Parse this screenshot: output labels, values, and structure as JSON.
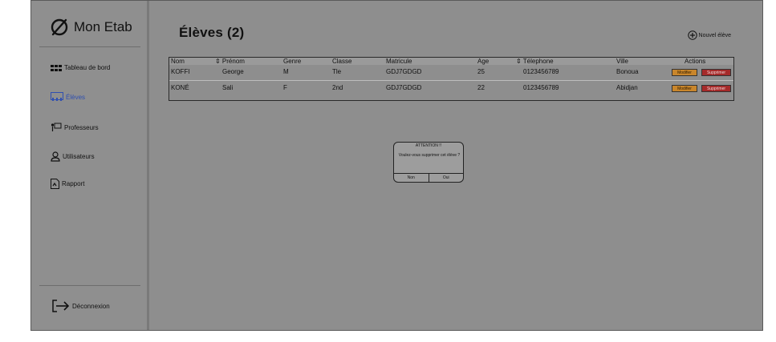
{
  "app": {
    "title": "Mon Etab"
  },
  "sidebar": {
    "items": [
      {
        "label": "Tableau de bord",
        "icon": "grid-icon"
      },
      {
        "label": "Élèves",
        "icon": "students-icon",
        "active": true
      },
      {
        "label": "Professeurs",
        "icon": "teacher-icon"
      },
      {
        "label": "Utilisateurs",
        "icon": "user-icon"
      },
      {
        "label": "Rapport",
        "icon": "report-icon"
      }
    ],
    "logout_label": "Déconnexion"
  },
  "main": {
    "title": "Élèves (2)",
    "new_button_label": "Nouvel élève"
  },
  "table": {
    "columns": [
      "Nom",
      "⇕ Prénom",
      "Genre",
      "Classe",
      "Matricule",
      "Age",
      "⇕ Télephone",
      "Ville",
      "Actions"
    ],
    "rows": [
      {
        "nom": "KOFFI",
        "prenom": "George",
        "genre": "M",
        "classe": "Tle",
        "matricule": "GDJ7GDGD",
        "age": "25",
        "telephone": "0123456789",
        "ville": "Bonoua"
      },
      {
        "nom": "KONÉ",
        "prenom": "Sali",
        "genre": "F",
        "classe": "2nd",
        "matricule": "GDJ7GDGD",
        "age": "22",
        "telephone": "0123456789",
        "ville": "Abidjan"
      }
    ],
    "modifier_label": "Modifier",
    "supprimer_label": "Supprimer"
  },
  "dialog": {
    "title": "ATTENTION !!",
    "message": "Voulez-vous supprimer cet élève ?",
    "no_label": "Non",
    "yes_label": "Oui"
  },
  "colors": {
    "overlay_gray": "#8e8e8e",
    "active_nav": "#2f4fb0",
    "modifier": "#c9862b",
    "supprimer": "#a52a2a"
  }
}
